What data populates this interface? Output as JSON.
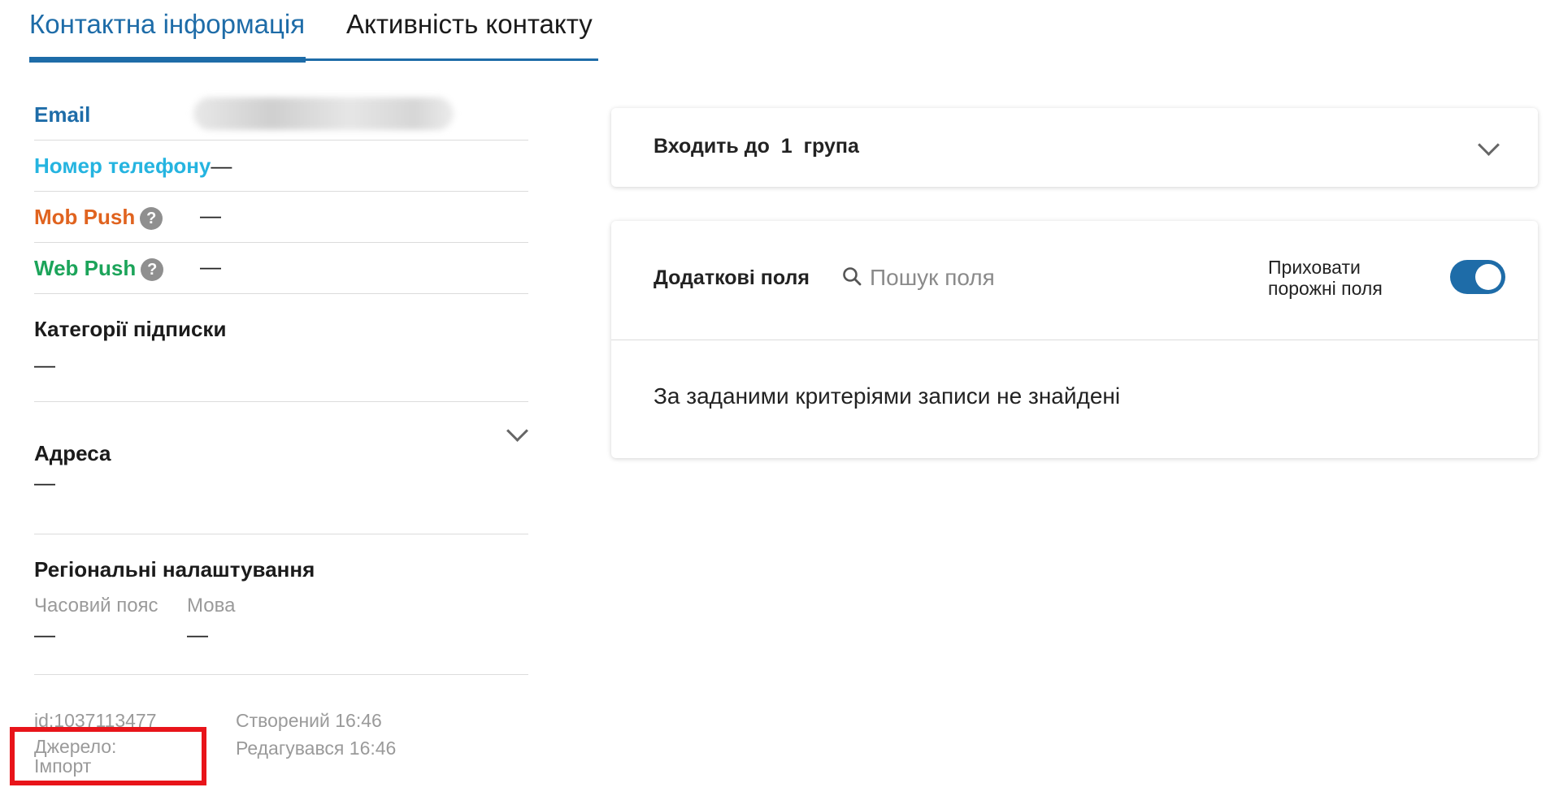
{
  "tabs": {
    "active": "Контактна інформація",
    "inactive": "Активність контакту"
  },
  "contact": {
    "email_label": "Email",
    "phone_label": "Номер телефону",
    "phone_value": "—",
    "mob_push_label": "Mob Push",
    "mob_push_value": "—",
    "web_push_label": "Web Push",
    "web_push_value": "—",
    "help_glyph": "?"
  },
  "subscription": {
    "title": "Категорії підписки",
    "value": "—"
  },
  "address": {
    "title": "Адреса",
    "value": "—"
  },
  "regional": {
    "title": "Регіональні налаштування",
    "timezone_label": "Часовий пояс",
    "timezone_value": "—",
    "language_label": "Мова",
    "language_value": "—"
  },
  "meta": {
    "id": "id:1037113477",
    "source_label": "Джерело:",
    "source_value": "Імпорт",
    "created": "Створений 16:46",
    "edited": "Редагувався 16:46"
  },
  "groups": {
    "prefix": "Входить до",
    "count": "1",
    "suffix": "група"
  },
  "extra_fields": {
    "title": "Додаткові поля",
    "search_placeholder": "Пошук поля",
    "hide_empty_line1": "Приховати",
    "hide_empty_line2": "порожні поля",
    "hide_empty_enabled": true,
    "empty_message": "За заданими критеріями записи не знайдені"
  },
  "colors": {
    "accent": "#1e6ca8",
    "email": "#1e6ca8",
    "phone": "#25b4e0",
    "mob_push": "#e0631f",
    "web_push": "#1ca45a",
    "highlight": "#e8141a"
  }
}
